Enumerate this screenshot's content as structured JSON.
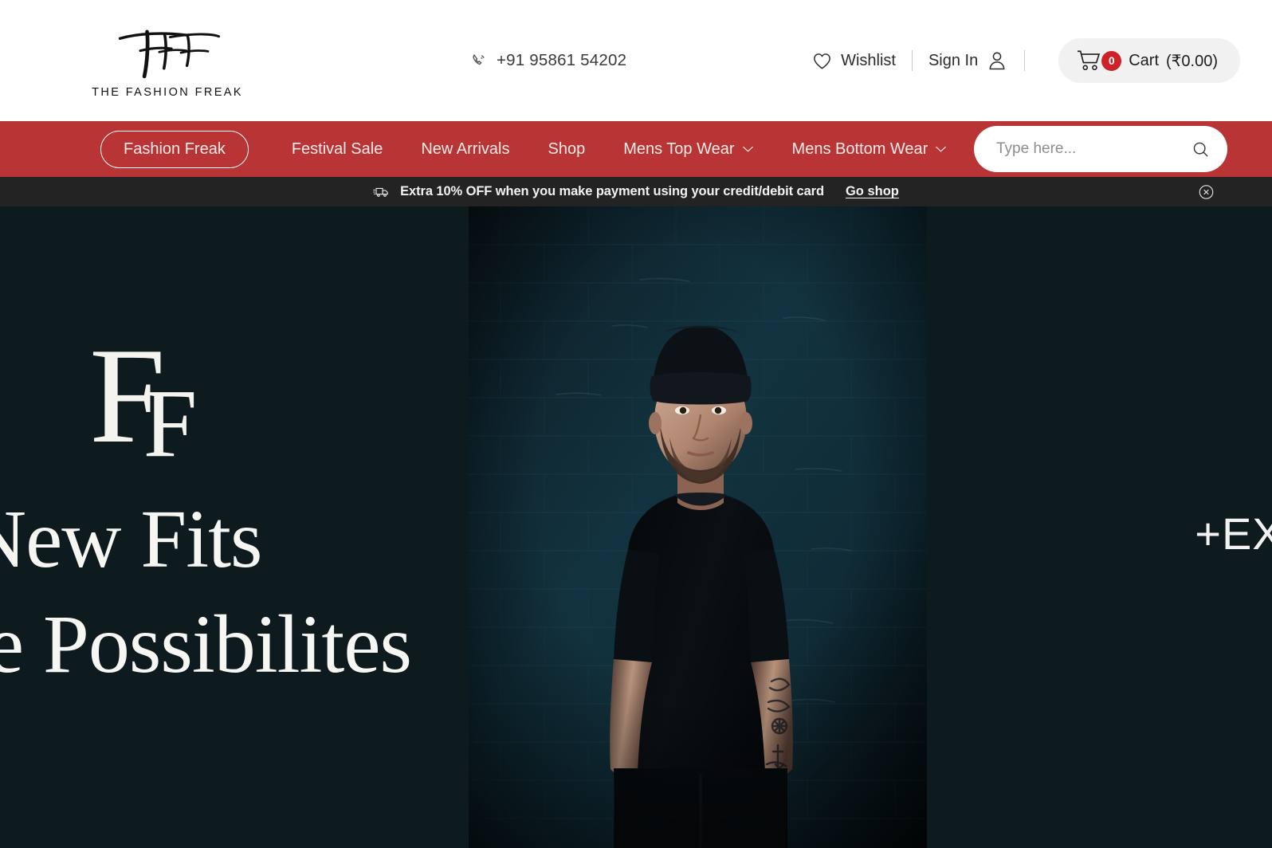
{
  "header": {
    "logo": {
      "mark": "TFF",
      "subtitle": "THE FASHION FREAK"
    },
    "phone": {
      "icon": "phone-icon",
      "number": "+91 95861 54202"
    },
    "wishlist": {
      "icon": "heart-icon",
      "label": "Wishlist"
    },
    "signin": {
      "label": "Sign In",
      "icon": "user-icon"
    },
    "cart": {
      "icon": "shopping-cart-icon",
      "count": "0",
      "label": "Cart",
      "price": "(₹0.00)",
      "badge_color": "#cc2229"
    }
  },
  "nav": {
    "background": "#b93434",
    "items": [
      {
        "label": "Fashion Freak",
        "active": true,
        "has_dropdown": false
      },
      {
        "label": "Festival Sale",
        "active": false,
        "has_dropdown": false
      },
      {
        "label": "New Arrivals",
        "active": false,
        "has_dropdown": false
      },
      {
        "label": "Shop",
        "active": false,
        "has_dropdown": false
      },
      {
        "label": "Mens Top Wear",
        "active": false,
        "has_dropdown": true
      },
      {
        "label": "Mens Bottom Wear",
        "active": false,
        "has_dropdown": true
      }
    ],
    "search": {
      "placeholder": "Type here...",
      "value": "",
      "icon": "search-icon"
    }
  },
  "promo": {
    "icon": "delivery-truck-icon",
    "text": "Extra 10% OFF when you make payment using your credit/debit card",
    "link": "Go shop",
    "close_icon": "close-circle-icon",
    "background": "#242323"
  },
  "hero": {
    "background": "#0d1a1e",
    "monogram": {
      "first": "F",
      "second": "F"
    },
    "line1": "New Fits",
    "line2": "te Possibilites",
    "right_text": "+EXP",
    "image_alt": "man-in-black-beanie-and-tshirt"
  }
}
